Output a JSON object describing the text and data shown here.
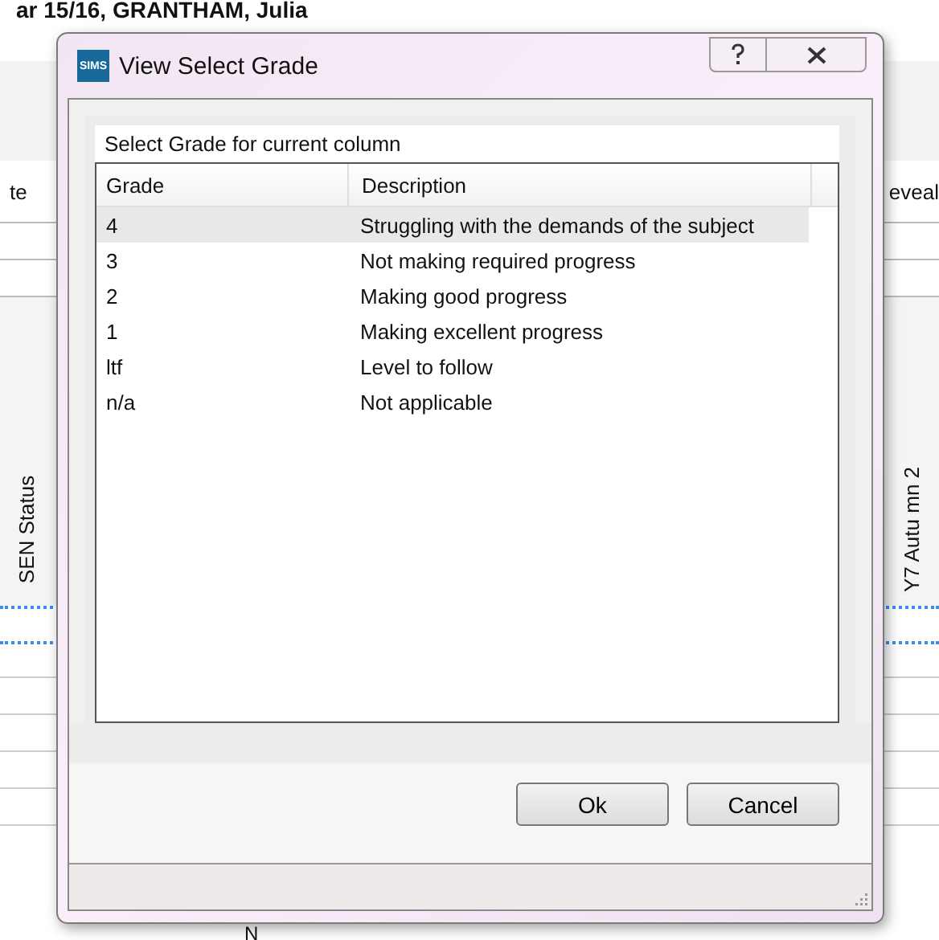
{
  "background": {
    "title": "ar 15/16, GRANTHAM, Julia",
    "left_header": "te",
    "right_header": "eveal",
    "left_vertical": "SEN Status",
    "right_vertical": "Y7 Autu mn 2",
    "cell": "N"
  },
  "dialog": {
    "logo": "SIMS",
    "title": "View Select Grade",
    "group_label": "Select Grade for current column",
    "columns": [
      "Grade",
      "Description"
    ],
    "rows": [
      {
        "grade": "4",
        "description": "Struggling with the demands of the subject",
        "selected": true
      },
      {
        "grade": "3",
        "description": "Not making required progress",
        "selected": false
      },
      {
        "grade": "2",
        "description": "Making good progress",
        "selected": false
      },
      {
        "grade": "1",
        "description": "Making excellent progress",
        "selected": false
      },
      {
        "grade": "ltf",
        "description": "Level to follow",
        "selected": false
      },
      {
        "grade": "n/a",
        "description": "Not applicable",
        "selected": false
      }
    ],
    "buttons": [
      "Ok",
      "Cancel"
    ]
  }
}
